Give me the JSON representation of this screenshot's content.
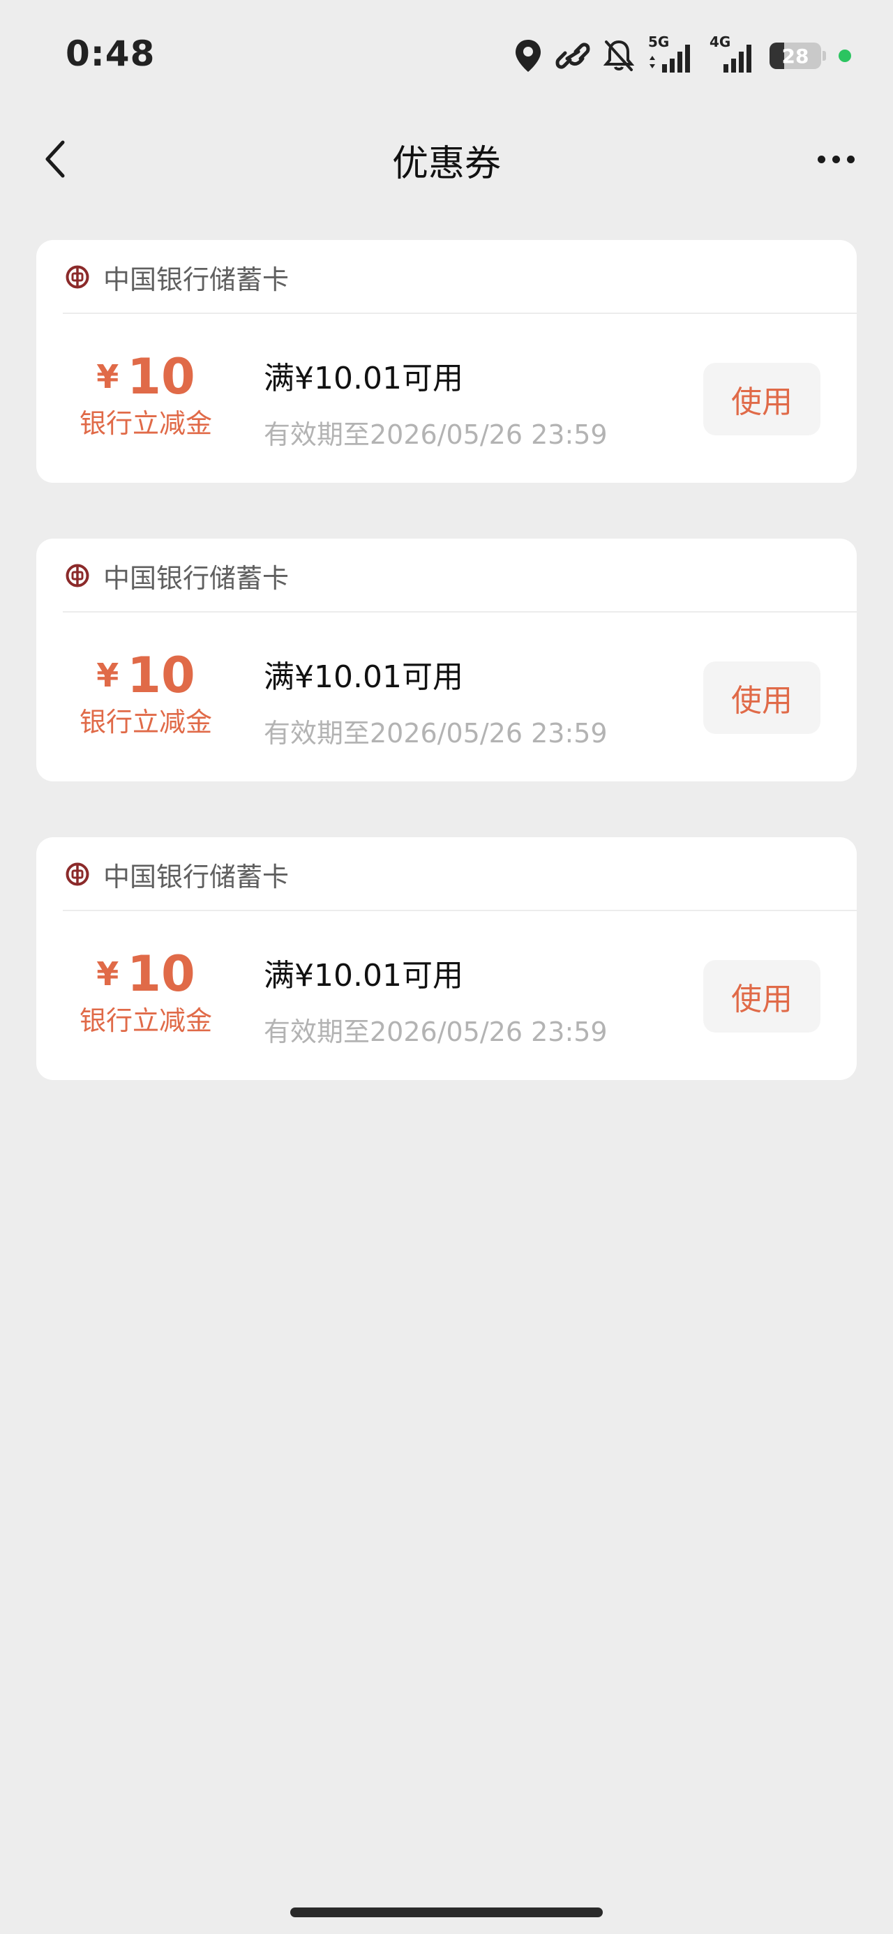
{
  "status_bar": {
    "time": "0:48",
    "network_1": "5G",
    "network_2": "4G",
    "battery": "28",
    "icons": [
      "location-icon",
      "link-icon",
      "bell-off-icon",
      "signal-5g-icon",
      "signal-4g-icon",
      "battery-icon",
      "green-dot"
    ],
    "dot_color": "#2bc460"
  },
  "nav": {
    "back_icon": "chevron-left-icon",
    "title": "优惠券",
    "more_icon": "more-dots-icon"
  },
  "colors": {
    "accent": "#e06a48",
    "background": "#ededed",
    "card": "#ffffff",
    "muted_text": "#b3b3b3",
    "bank_logo": "#8b2a2a"
  },
  "coupons": [
    {
      "bank_logo_icon": "boc-logo-icon",
      "bank_name": "中国银行储蓄卡",
      "currency": "¥",
      "amount": "10",
      "amount_desc": "银行立减金",
      "condition": "满¥10.01可用",
      "validity": "有效期至2026/05/26 23:59",
      "button_label": "使用"
    },
    {
      "bank_logo_icon": "boc-logo-icon",
      "bank_name": "中国银行储蓄卡",
      "currency": "¥",
      "amount": "10",
      "amount_desc": "银行立减金",
      "condition": "满¥10.01可用",
      "validity": "有效期至2026/05/26 23:59",
      "button_label": "使用"
    },
    {
      "bank_logo_icon": "boc-logo-icon",
      "bank_name": "中国银行储蓄卡",
      "currency": "¥",
      "amount": "10",
      "amount_desc": "银行立减金",
      "condition": "满¥10.01可用",
      "validity": "有效期至2026/05/26 23:59",
      "button_label": "使用"
    }
  ]
}
